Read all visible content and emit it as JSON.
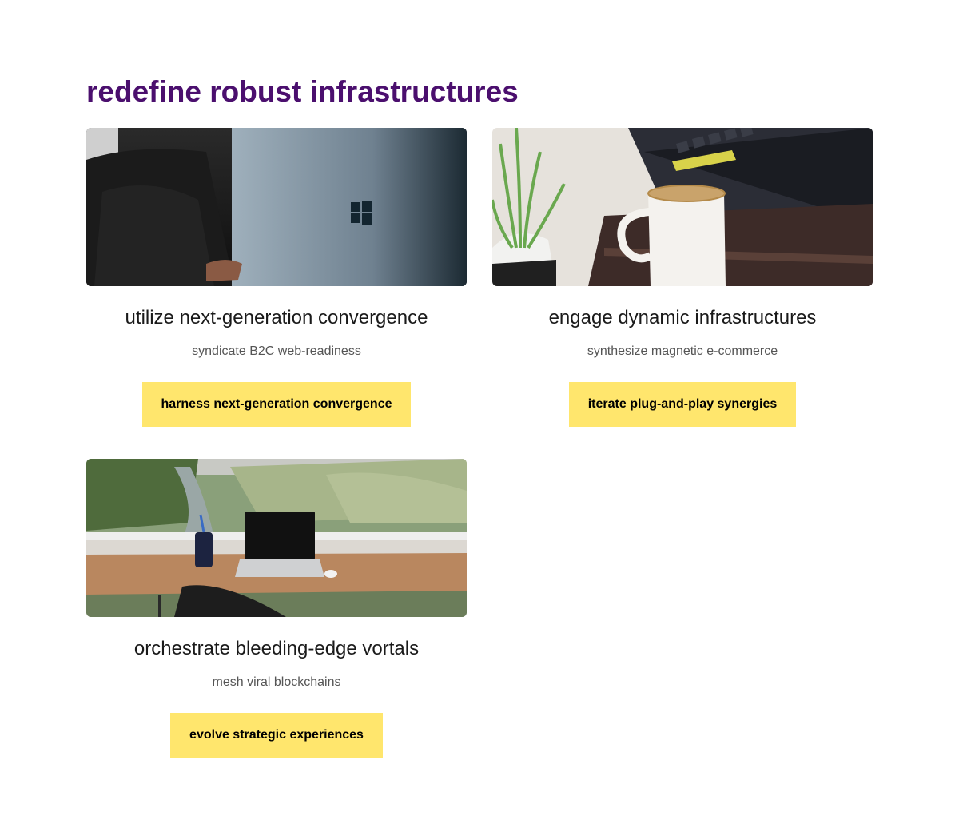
{
  "section": {
    "title": "redefine robust infrastructures"
  },
  "cards": [
    {
      "title": "utilize next-generation convergence",
      "subtitle": "syndicate B2C web-readiness",
      "button_label": "harness next-generation convergence",
      "image_icon": "laptop-photo"
    },
    {
      "title": "engage dynamic infrastructures",
      "subtitle": "synthesize magnetic e-commerce",
      "button_label": "iterate plug-and-play synergies",
      "image_icon": "coffee-keyboard-photo"
    },
    {
      "title": "orchestrate bleeding-edge vortals",
      "subtitle": "mesh viral blockchains",
      "button_label": "evolve strategic experiences",
      "image_icon": "desk-view-photo"
    }
  ],
  "colors": {
    "heading": "#4b0f6e",
    "button": "#ffe66d",
    "text": "#1a1a1a",
    "muted": "#555555"
  }
}
